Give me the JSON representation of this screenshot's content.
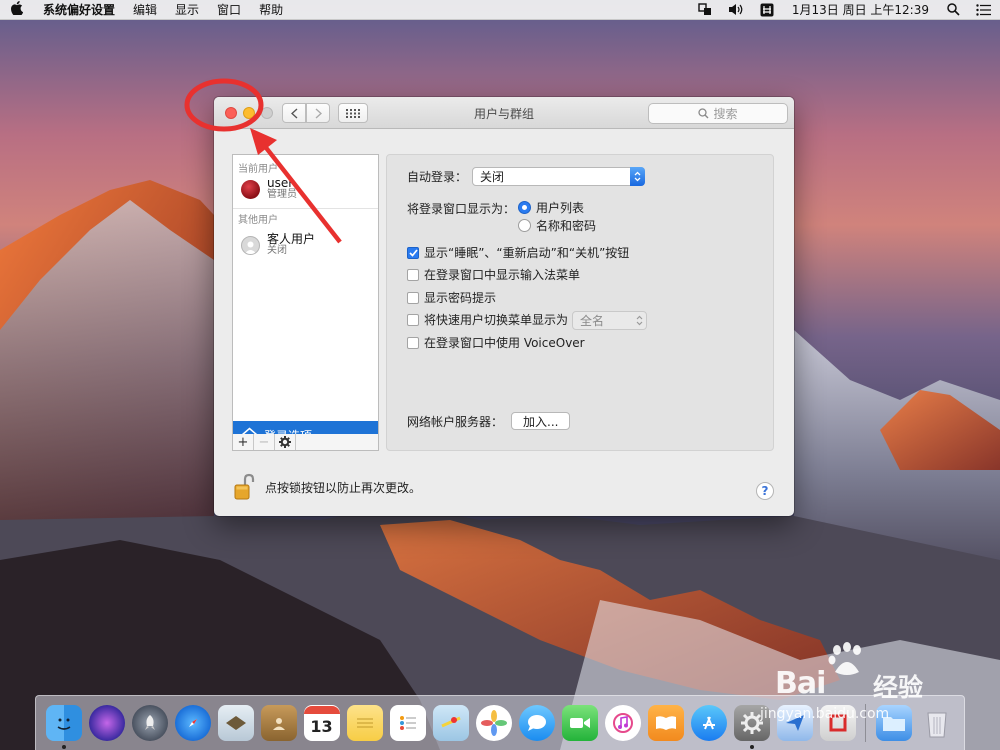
{
  "menubar": {
    "app_name": "系统偏好设置",
    "menus": [
      "编辑",
      "显示",
      "窗口",
      "帮助"
    ],
    "clock": "1月13日 周日 上午12:39"
  },
  "window": {
    "title": "用户与群组",
    "search_placeholder": "搜索"
  },
  "user_list": {
    "current_section": "当前用户",
    "current_user": {
      "name": "user",
      "role": "管理员"
    },
    "other_section": "其他用户",
    "guest_user": {
      "name": "客人用户",
      "status": "关闭"
    },
    "login_options": "登录选项",
    "toolbar": {
      "add": "+",
      "remove": "−"
    }
  },
  "login_settings": {
    "auto_login_label": "自动登录：",
    "auto_login_value": "关闭",
    "display_label": "将登录窗口显示为：",
    "display_options": [
      "用户列表",
      "名称和密码"
    ],
    "display_selected": "用户列表",
    "checkboxes": [
      {
        "label": "显示“睡眠”、“重新启动”和“关机”按钮",
        "checked": true
      },
      {
        "label": "在登录窗口中显示输入法菜单",
        "checked": false
      },
      {
        "label": "显示密码提示",
        "checked": false
      },
      {
        "label": "将快速用户切换菜单显示为",
        "checked": false
      },
      {
        "label": "在登录窗口中使用 VoiceOver",
        "checked": false
      }
    ],
    "fast_switch_value": "全名",
    "network_server_label": "网络帐户服务器：",
    "join_button": "加入..."
  },
  "footer": {
    "lock_text": "点按锁按钮以防止再次更改。",
    "help": "?"
  },
  "dock": {
    "calendar_day": "13"
  },
  "watermark": {
    "brand": "Bai",
    "brand_cn": "经验",
    "url": "jingyan.baidu.com"
  },
  "colors": {
    "accent": "#1e73d6",
    "annotation": "#e8312f"
  }
}
